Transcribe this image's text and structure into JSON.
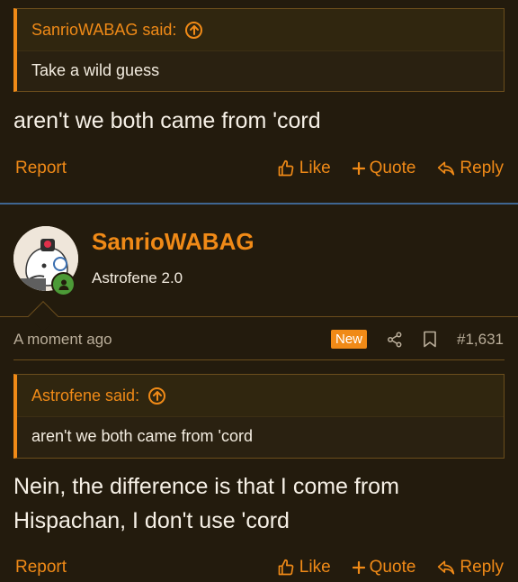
{
  "post1": {
    "quote": {
      "author_said": "SanrioWABAG said:",
      "text": "Take a wild guess"
    },
    "message": "aren't we both came from 'cord",
    "actions": {
      "report": "Report",
      "like": "Like",
      "quote": "Quote",
      "reply": "Reply"
    }
  },
  "post2": {
    "user": {
      "name": "SanrioWABAG",
      "title": "Astrofene 2.0"
    },
    "meta": {
      "time": "A moment ago",
      "new_badge": "New",
      "post_number": "#1,631"
    },
    "quote": {
      "author_said": "Astrofene said:",
      "text": "aren't we both came from 'cord"
    },
    "message_line1": "Nein, the difference is that I come from",
    "message_line2": "Hispachan, I don't use 'cord",
    "actions": {
      "report": "Report",
      "like": "Like",
      "quote": "Quote",
      "reply": "Reply"
    }
  },
  "colors": {
    "accent": "#f08a17",
    "background": "#231b0d",
    "separator": "#3f6691",
    "online": "#4c9a37"
  }
}
